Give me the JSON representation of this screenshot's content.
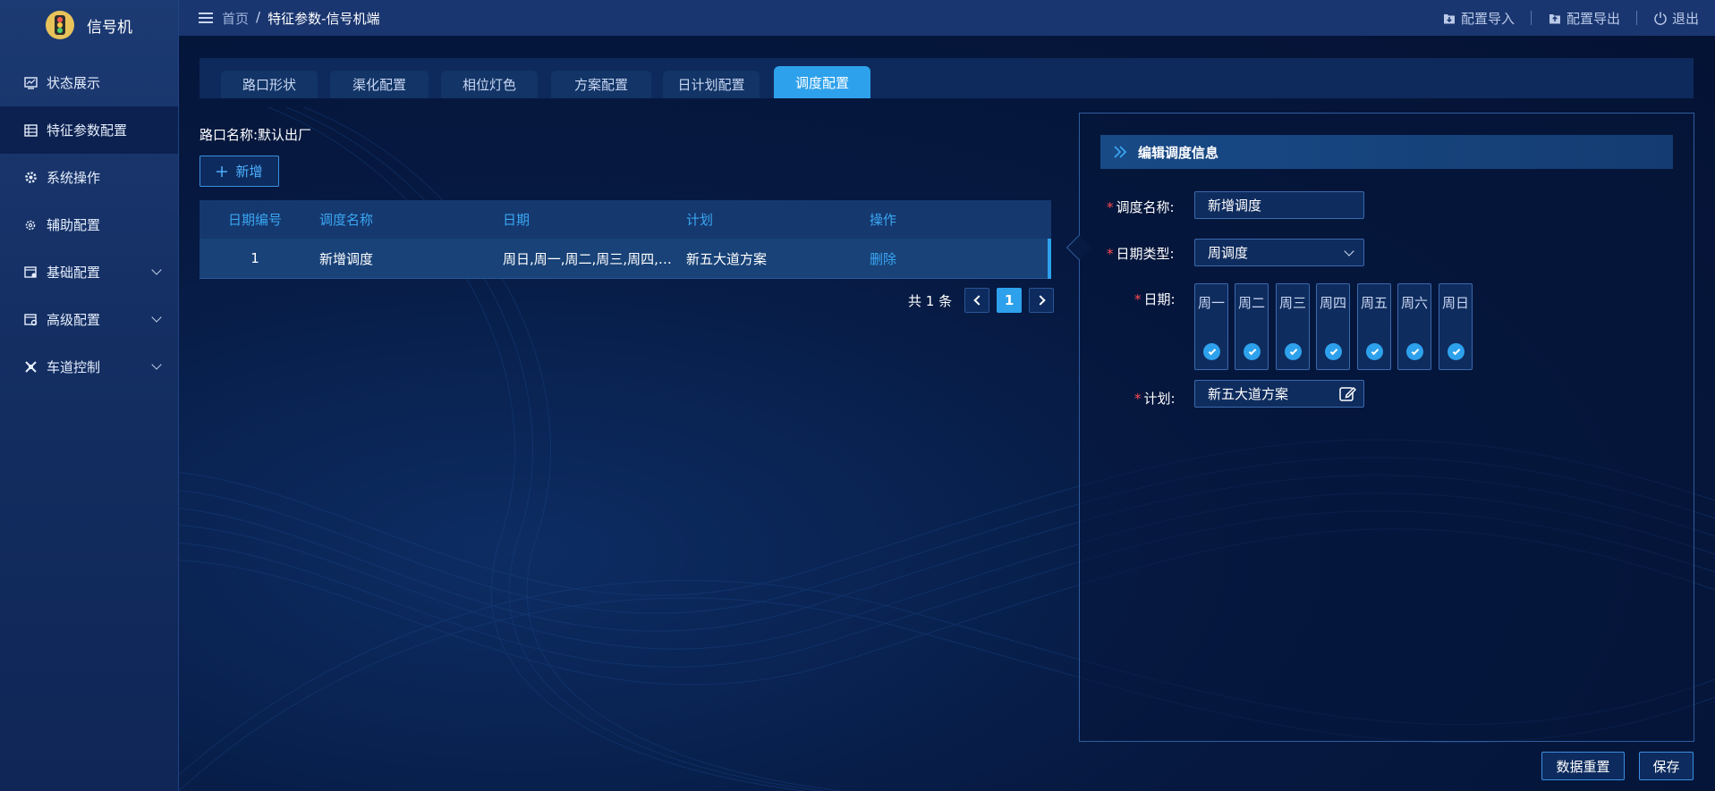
{
  "app": {
    "title": "信号机"
  },
  "sidebar": {
    "items": [
      {
        "label": "状态展示",
        "icon": "monitor-icon"
      },
      {
        "label": "特征参数配置",
        "icon": "table-icon",
        "active": true
      },
      {
        "label": "系统操作",
        "icon": "gear-icon"
      },
      {
        "label": "辅助配置",
        "icon": "settings-small-icon"
      },
      {
        "label": "基础配置",
        "icon": "config-icon",
        "expandable": true
      },
      {
        "label": "高级配置",
        "icon": "advanced-config-icon",
        "expandable": true
      },
      {
        "label": "车道控制",
        "icon": "lane-control-icon",
        "expandable": true
      }
    ]
  },
  "header": {
    "breadcrumb": {
      "home": "首页",
      "separator": "/",
      "current": "特征参数-信号机端"
    },
    "actions": {
      "import": "配置导入",
      "export": "配置导出",
      "logout": "退出"
    }
  },
  "tabs": [
    {
      "label": "路口形状"
    },
    {
      "label": "渠化配置"
    },
    {
      "label": "相位灯色"
    },
    {
      "label": "方案配置"
    },
    {
      "label": "日计划配置"
    },
    {
      "label": "调度配置",
      "active": true
    }
  ],
  "main": {
    "crossing_label": "路口名称:默认出厂",
    "add_button": "新增",
    "table": {
      "columns": [
        "日期编号",
        "调度名称",
        "日期",
        "计划",
        "操作"
      ],
      "rows": [
        {
          "id": "1",
          "name": "新增调度",
          "dates": "周日,周一,周二,周三,周四,周五,周六",
          "plan": "新五大道方案",
          "action": "删除"
        }
      ]
    },
    "pagination": {
      "total_text": "共 1 条",
      "current_page": "1"
    }
  },
  "panel": {
    "title": "编辑调度信息",
    "name_label": "调度名称:",
    "name_value": "新增调度",
    "date_type_label": "日期类型:",
    "date_type_value": "周调度",
    "date_label": "日期:",
    "days": [
      "周一",
      "周二",
      "周三",
      "周四",
      "周五",
      "周六",
      "周日"
    ],
    "plan_label": "计划:",
    "plan_value": "新五大道方案"
  },
  "footer": {
    "reset": "数据重置",
    "save": "保存"
  },
  "colors": {
    "accent": "#2ea1ec",
    "required": "#ff4d4f",
    "link": "#3aa6f2"
  }
}
